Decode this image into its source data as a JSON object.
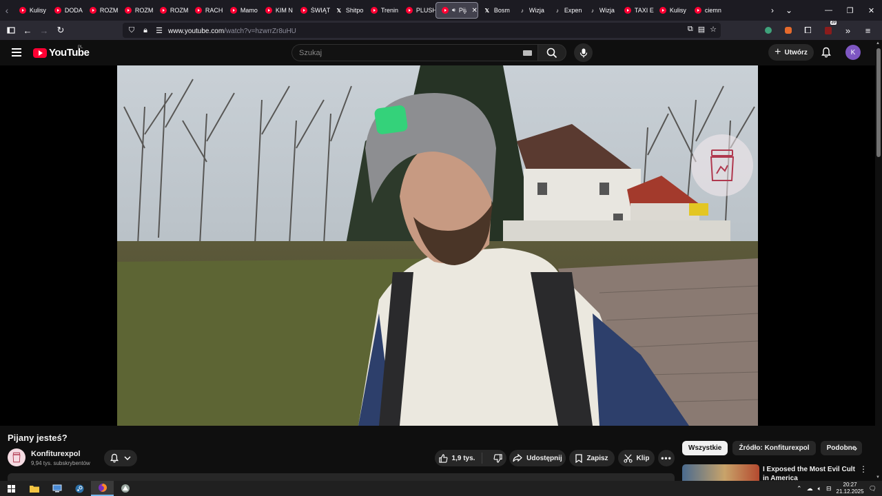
{
  "browser": {
    "tabs": [
      {
        "label": "Kulisy",
        "favicon": "youtube-icon"
      },
      {
        "label": "DODA",
        "favicon": "youtube-icon"
      },
      {
        "label": "ROZM",
        "favicon": "youtube-icon"
      },
      {
        "label": "ROZM",
        "favicon": "youtube-icon"
      },
      {
        "label": "ROZM",
        "favicon": "youtube-icon"
      },
      {
        "label": "RACH",
        "favicon": "youtube-icon"
      },
      {
        "label": "Mamo",
        "favicon": "youtube-icon"
      },
      {
        "label": "KIM N",
        "favicon": "youtube-icon"
      },
      {
        "label": "ŚWIĄT",
        "favicon": "youtube-icon"
      },
      {
        "label": "Shitpo",
        "favicon": "x-icon"
      },
      {
        "label": "Trenin",
        "favicon": "youtube-icon"
      },
      {
        "label": "PLUSH",
        "favicon": "youtube-icon"
      },
      {
        "label": "Pija",
        "favicon": "youtube-icon",
        "active": true
      },
      {
        "label": "Bosm",
        "favicon": "x-icon"
      },
      {
        "label": "Wizja",
        "favicon": "tiktok-icon"
      },
      {
        "label": "Expen",
        "favicon": "tiktok-icon"
      },
      {
        "label": "Wizja",
        "favicon": "tiktok-icon"
      },
      {
        "label": "TAXI E",
        "favicon": "youtube-icon"
      },
      {
        "label": "Kulisy",
        "favicon": "youtube-icon"
      },
      {
        "label": "ciemn",
        "favicon": "youtube-icon"
      }
    ],
    "url_host": "www.youtube.com",
    "url_path": "/watch?v=hzwrrZr8uHU",
    "extension_badge": "20"
  },
  "youtube": {
    "logo_text": "YouTube",
    "country_code": "PL",
    "search_placeholder": "Szukaj",
    "create_label": "Utwórz",
    "avatar_letter": "K"
  },
  "video": {
    "title": "Pijany jesteś?",
    "channel_name": "Konfiturexpol",
    "subscribers": "9,94 tys. subskrybentów",
    "likes": "1,9 tys.",
    "share_label": "Udostępnij",
    "save_label": "Zapisz",
    "clip_label": "Klip"
  },
  "sidebar": {
    "chips": [
      "Wszystkie",
      "Źródło: Konfiturexpol",
      "Podobne"
    ],
    "recommendation_title": "I Exposed the Most Evil Cult in America"
  },
  "taskbar": {
    "time": "20:27",
    "date": "21.12.2025"
  },
  "colors": {
    "yt_red": "#ff0033",
    "background": "#0f0f0f",
    "avatar": "#7e57c2"
  }
}
